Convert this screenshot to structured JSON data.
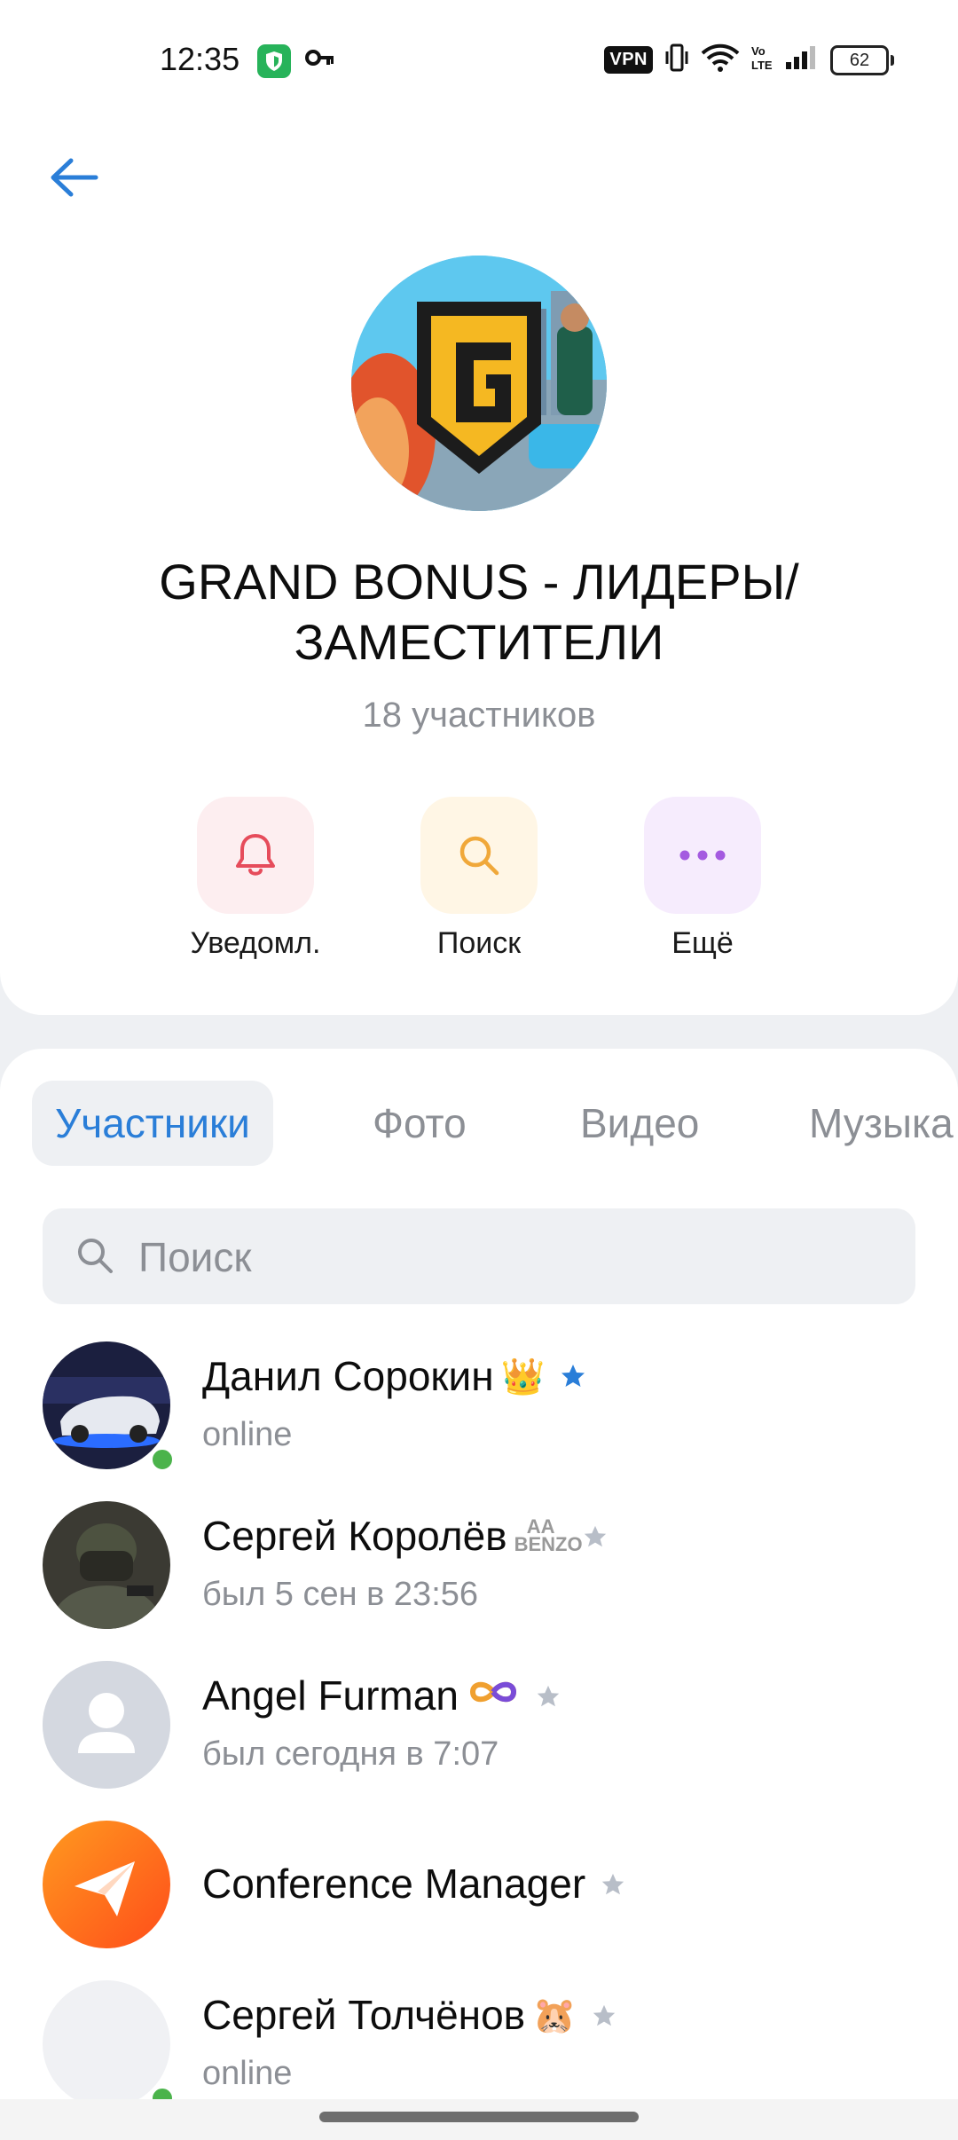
{
  "status_bar": {
    "time": "12:35",
    "vpn": "VPN",
    "battery": "62"
  },
  "header": {
    "title": "GRAND BONUS - ЛИДЕРЫ/ ЗАМЕСТИТЕЛИ",
    "subtitle": "18 участников",
    "actions": [
      {
        "label": "Уведомл.",
        "icon": "bell-icon",
        "bg": "#fdeef0",
        "color": "#e64c5b"
      },
      {
        "label": "Поиск",
        "icon": "search-icon",
        "bg": "#fff6e5",
        "color": "#f0a83a"
      },
      {
        "label": "Ещё",
        "icon": "more-icon",
        "bg": "#f6ecfd",
        "color": "#a45ae0"
      }
    ]
  },
  "tabs": {
    "items": [
      "Участники",
      "Фото",
      "Видео",
      "Музыка"
    ],
    "active": "Участники"
  },
  "search": {
    "placeholder": "Поиск"
  },
  "members": [
    {
      "name": "Данил Сорокин",
      "badge": "👑",
      "status": "online",
      "online": true,
      "star": "blue"
    },
    {
      "name": "Сергей Королёв",
      "badge": "AA BENZO",
      "status": "был 5 сен в 23:56",
      "online": false,
      "star": "grey"
    },
    {
      "name": "Angel Furman",
      "badge": "♾",
      "status": "был сегодня в 7:07",
      "online": false,
      "star": "grey"
    },
    {
      "name": "Conference Manager",
      "badge": "",
      "status": "",
      "online": false,
      "star": "grey"
    },
    {
      "name": "Сергей Толчёнов",
      "badge": "🐹",
      "status": "online",
      "online": true,
      "star": "grey"
    }
  ],
  "colors": {
    "accent": "#2a7ed8",
    "online": "#4bb34b",
    "secondary_text": "#8c8f95",
    "star_blue": "#2a7ed8",
    "star_grey": "#b8bec8"
  }
}
